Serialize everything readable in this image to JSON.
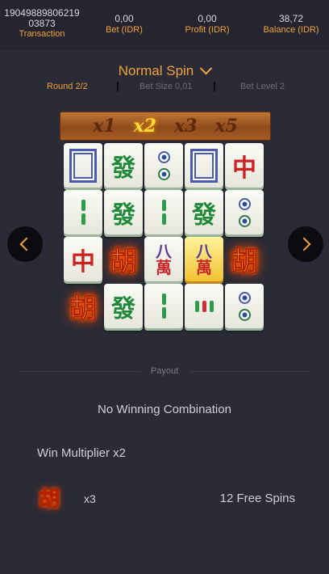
{
  "header": {
    "transaction": {
      "value": "1904988980621903873",
      "label": "Transaction"
    },
    "bet": {
      "value": "0,00",
      "label": "Bet (IDR)"
    },
    "profit": {
      "value": "0,00",
      "label": "Profit (IDR)"
    },
    "balance": {
      "value": "38,72",
      "label": "Balance (IDR)"
    }
  },
  "spin": {
    "title": "Normal Spin",
    "round": "Round 2/2",
    "bet_size": "Bet Size 0,01",
    "bet_level": "Bet Level 2"
  },
  "multipliers": [
    "x1",
    "x2",
    "x3",
    "x5"
  ],
  "active_multiplier": "x2",
  "reels": [
    [
      {
        "t": "white-dragon"
      },
      {
        "t": "green-dragon",
        "s": "發"
      },
      {
        "t": "circle-2"
      },
      {
        "t": "white-dragon"
      },
      {
        "t": "red-dragon",
        "s": "中"
      }
    ],
    [
      {
        "t": "bamboo-2"
      },
      {
        "t": "green-dragon",
        "s": "發"
      },
      {
        "t": "bamboo-2"
      },
      {
        "t": "green-dragon",
        "s": "發"
      },
      {
        "t": "circle-2"
      }
    ],
    [
      {
        "t": "red-dragon",
        "s": "中"
      },
      {
        "t": "wild",
        "s": "胡"
      },
      {
        "t": "character-8",
        "s1": "八",
        "s2": "萬"
      },
      {
        "t": "character-8-gold",
        "s1": "八",
        "s2": "萬"
      },
      {
        "t": "wild",
        "s": "胡"
      }
    ],
    [
      {
        "t": "wild",
        "s": "胡"
      },
      {
        "t": "green-dragon",
        "s": "發"
      },
      {
        "t": "bamboo-2"
      },
      {
        "t": "bamboo-3"
      },
      {
        "t": "circle-2"
      }
    ]
  ],
  "payout": {
    "label": "Payout",
    "result": "No Winning Combination",
    "win_multiplier": "Win Multiplier x2",
    "scatter_symbol": "胡",
    "scatter_count": "x3",
    "free_spins": "12 Free Spins"
  },
  "colors": {
    "accent": "#f0a23a",
    "background": "#2a2b36"
  },
  "icons": {
    "prev": "chevron-left-icon",
    "next": "chevron-right-icon",
    "dropdown": "chevron-down-icon"
  }
}
